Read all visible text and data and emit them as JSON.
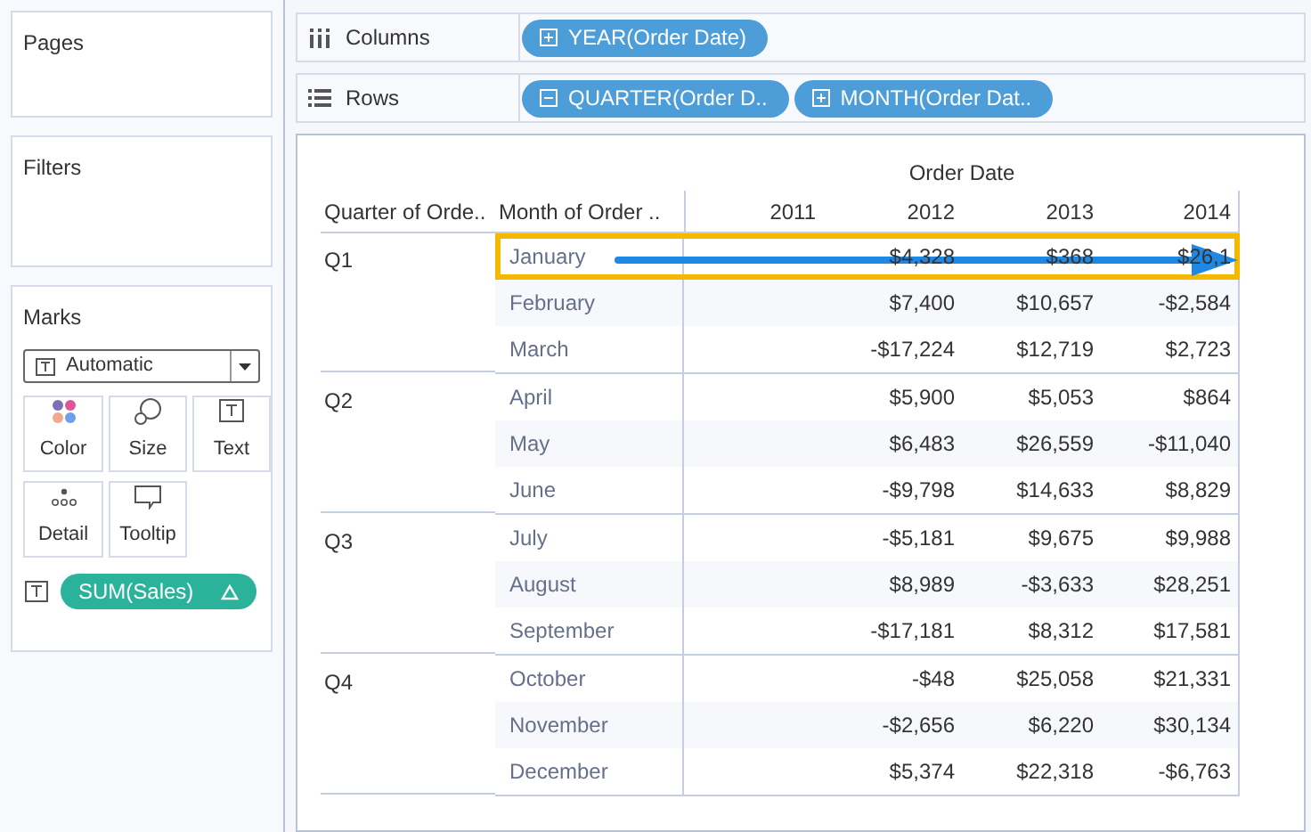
{
  "sidebar": {
    "pages": {
      "title": "Pages"
    },
    "filters": {
      "title": "Filters"
    },
    "marks": {
      "title": "Marks",
      "mark_type": "Automatic",
      "cards": [
        {
          "label": "Color",
          "kind": "color"
        },
        {
          "label": "Size",
          "kind": "size"
        },
        {
          "label": "Text",
          "kind": "text"
        },
        {
          "label": "Detail",
          "kind": "detail"
        },
        {
          "label": "Tooltip",
          "kind": "tooltip"
        }
      ],
      "field": {
        "label": "SUM(Sales)"
      }
    }
  },
  "shelves": [
    {
      "label": "Columns",
      "kind": "columns",
      "pills": [
        {
          "label": "YEAR(Order Date)",
          "expanded": false
        }
      ]
    },
    {
      "label": "Rows",
      "kind": "rows",
      "pills": [
        {
          "label": "QUARTER(Order D..",
          "expanded": true
        },
        {
          "label": "MONTH(Order Dat..",
          "expanded": false
        }
      ]
    }
  ],
  "table": {
    "header": "Order Date",
    "columns": [
      "Quarter of Orde..",
      "Month of Order ..",
      "2011",
      "2012",
      "2013",
      "2014"
    ],
    "groups": [
      {
        "quarter": "Q1",
        "rows": [
          {
            "month": "January",
            "highlighted": true,
            "values": [
              "$4,328",
              "$368",
              "$26,1"
            ]
          },
          {
            "month": "February",
            "highlighted": false,
            "values": [
              "$7,400",
              "$10,657",
              "-$2,584"
            ]
          },
          {
            "month": "March",
            "highlighted": false,
            "values": [
              "-$17,224",
              "$12,719",
              "$2,723"
            ]
          }
        ]
      },
      {
        "quarter": "Q2",
        "rows": [
          {
            "month": "April",
            "highlighted": false,
            "values": [
              "$5,900",
              "$5,053",
              "$864"
            ]
          },
          {
            "month": "May",
            "highlighted": false,
            "values": [
              "$6,483",
              "$26,559",
              "-$11,040"
            ]
          },
          {
            "month": "June",
            "highlighted": false,
            "values": [
              "-$9,798",
              "$14,633",
              "$8,829"
            ]
          }
        ]
      },
      {
        "quarter": "Q3",
        "rows": [
          {
            "month": "July",
            "highlighted": false,
            "values": [
              "-$5,181",
              "$9,675",
              "$9,988"
            ]
          },
          {
            "month": "August",
            "highlighted": false,
            "values": [
              "$8,989",
              "-$3,633",
              "$28,251"
            ]
          },
          {
            "month": "September",
            "highlighted": false,
            "values": [
              "-$17,181",
              "$8,312",
              "$17,581"
            ]
          }
        ]
      },
      {
        "quarter": "Q4",
        "rows": [
          {
            "month": "October",
            "highlighted": false,
            "values": [
              "-$48",
              "$25,058",
              "$21,331"
            ]
          },
          {
            "month": "November",
            "highlighted": false,
            "values": [
              "-$2,656",
              "$6,220",
              "$30,134"
            ]
          },
          {
            "month": "December",
            "highlighted": false,
            "values": [
              "$5,374",
              "$22,318",
              "-$6,763"
            ]
          }
        ]
      }
    ]
  }
}
